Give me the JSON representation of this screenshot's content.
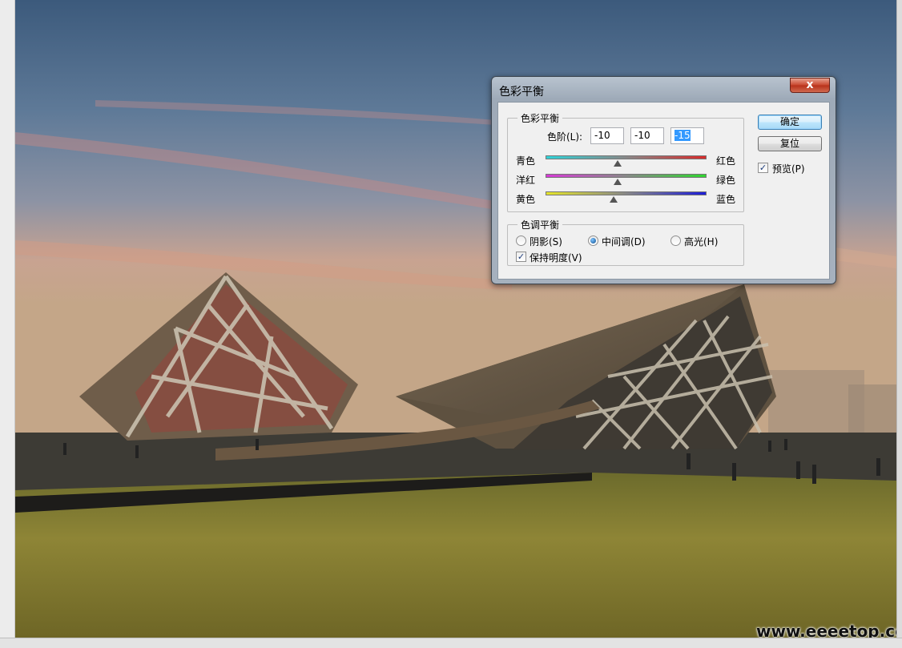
{
  "watermark": "www.eeeetop.com",
  "dialog": {
    "title": "色彩平衡",
    "close_glyph": "x",
    "color_balance": {
      "group_label": "色彩平衡",
      "levels_label": "色阶(L):",
      "levels": [
        "-10",
        "-10",
        "-15"
      ],
      "sliders": [
        {
          "left": "青色",
          "right": "红色",
          "value": -10,
          "min": -100,
          "max": 100,
          "from_color": "#2fd3d8",
          "to_color": "#d82a2a"
        },
        {
          "left": "洋红",
          "right": "绿色",
          "value": -10,
          "min": -100,
          "max": 100,
          "from_color": "#d63ad6",
          "to_color": "#2fd62f"
        },
        {
          "left": "黄色",
          "right": "蓝色",
          "value": -15,
          "min": -100,
          "max": 100,
          "from_color": "#e5e52a",
          "to_color": "#1d1dd8"
        }
      ]
    },
    "tone_balance": {
      "group_label": "色调平衡",
      "options": [
        "阴影(S)",
        "中间调(D)",
        "高光(H)"
      ],
      "selected": 1,
      "preserve_label": "保持明度(V)",
      "preserve_checked": true
    },
    "ok_label": "确定",
    "reset_label": "复位",
    "preview_label": "预览(P)",
    "preview_checked": true
  }
}
